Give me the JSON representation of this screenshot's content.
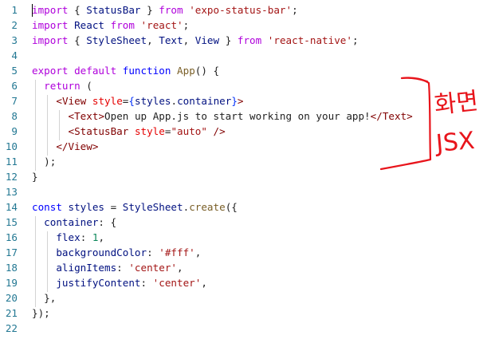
{
  "editor": {
    "lines": [
      {
        "n": "1",
        "tokens": [
          [
            "kw",
            "import"
          ],
          [
            "p",
            " { "
          ],
          [
            "v",
            "StatusBar"
          ],
          [
            "p",
            " } "
          ],
          [
            "kw",
            "from"
          ],
          [
            "p",
            " "
          ],
          [
            "s",
            "'expo-status-bar'"
          ],
          [
            "p",
            ";"
          ]
        ]
      },
      {
        "n": "2",
        "tokens": [
          [
            "kw",
            "import"
          ],
          [
            "p",
            " "
          ],
          [
            "v",
            "React"
          ],
          [
            "p",
            " "
          ],
          [
            "kw",
            "from"
          ],
          [
            "p",
            " "
          ],
          [
            "s",
            "'react'"
          ],
          [
            "p",
            ";"
          ]
        ]
      },
      {
        "n": "3",
        "tokens": [
          [
            "kw",
            "import"
          ],
          [
            "p",
            " { "
          ],
          [
            "v",
            "StyleSheet"
          ],
          [
            "p",
            ", "
          ],
          [
            "v",
            "Text"
          ],
          [
            "p",
            ", "
          ],
          [
            "v",
            "View"
          ],
          [
            "p",
            " } "
          ],
          [
            "kw",
            "from"
          ],
          [
            "p",
            " "
          ],
          [
            "s",
            "'react-native'"
          ],
          [
            "p",
            ";"
          ]
        ]
      },
      {
        "n": "4",
        "tokens": []
      },
      {
        "n": "5",
        "tokens": [
          [
            "kw",
            "export"
          ],
          [
            "p",
            " "
          ],
          [
            "kw",
            "default"
          ],
          [
            "p",
            " "
          ],
          [
            "k2",
            "function"
          ],
          [
            "p",
            " "
          ],
          [
            "f",
            "App"
          ],
          [
            "p",
            "() {"
          ]
        ]
      },
      {
        "n": "6",
        "tokens": [
          [
            "p",
            "  "
          ],
          [
            "kw",
            "return"
          ],
          [
            "p",
            " ("
          ]
        ]
      },
      {
        "n": "7",
        "tokens": [
          [
            "p",
            "    "
          ],
          [
            "tg",
            "<"
          ],
          [
            "tg",
            "View"
          ],
          [
            "p",
            " "
          ],
          [
            "at",
            "style"
          ],
          [
            "p",
            "="
          ],
          [
            "b",
            "{"
          ],
          [
            "v",
            "styles"
          ],
          [
            "p",
            "."
          ],
          [
            "v",
            "container"
          ],
          [
            "b",
            "}"
          ],
          [
            "tg",
            ">"
          ]
        ]
      },
      {
        "n": "8",
        "tokens": [
          [
            "p",
            "      "
          ],
          [
            "tg",
            "<"
          ],
          [
            "tg",
            "Text"
          ],
          [
            "tg",
            ">"
          ],
          [
            "p",
            "Open up App.js to start working on your app!"
          ],
          [
            "tg",
            "</"
          ],
          [
            "tg",
            "Text"
          ],
          [
            "tg",
            ">"
          ]
        ]
      },
      {
        "n": "9",
        "tokens": [
          [
            "p",
            "      "
          ],
          [
            "tg",
            "<"
          ],
          [
            "tg",
            "StatusBar"
          ],
          [
            "p",
            " "
          ],
          [
            "at",
            "style"
          ],
          [
            "p",
            "="
          ],
          [
            "s",
            "\"auto\""
          ],
          [
            "p",
            " "
          ],
          [
            "tg",
            "/>"
          ]
        ]
      },
      {
        "n": "10",
        "tokens": [
          [
            "p",
            "    "
          ],
          [
            "tg",
            "</"
          ],
          [
            "tg",
            "View"
          ],
          [
            "tg",
            ">"
          ]
        ]
      },
      {
        "n": "11",
        "tokens": [
          [
            "p",
            "  );"
          ]
        ]
      },
      {
        "n": "12",
        "tokens": [
          [
            "p",
            "}"
          ]
        ]
      },
      {
        "n": "13",
        "tokens": []
      },
      {
        "n": "14",
        "tokens": [
          [
            "k2",
            "const"
          ],
          [
            "p",
            " "
          ],
          [
            "v",
            "styles"
          ],
          [
            "p",
            " = "
          ],
          [
            "v",
            "StyleSheet"
          ],
          [
            "p",
            "."
          ],
          [
            "f",
            "create"
          ],
          [
            "p",
            "({"
          ]
        ]
      },
      {
        "n": "15",
        "tokens": [
          [
            "p",
            "  "
          ],
          [
            "v",
            "container"
          ],
          [
            "p",
            ": {"
          ]
        ]
      },
      {
        "n": "16",
        "tokens": [
          [
            "p",
            "    "
          ],
          [
            "v",
            "flex"
          ],
          [
            "p",
            ": "
          ],
          [
            "num",
            "1"
          ],
          [
            "p",
            ","
          ]
        ]
      },
      {
        "n": "17",
        "tokens": [
          [
            "p",
            "    "
          ],
          [
            "v",
            "backgroundColor"
          ],
          [
            "p",
            ": "
          ],
          [
            "s",
            "'#fff'"
          ],
          [
            "p",
            ","
          ]
        ]
      },
      {
        "n": "18",
        "tokens": [
          [
            "p",
            "    "
          ],
          [
            "v",
            "alignItems"
          ],
          [
            "p",
            ": "
          ],
          [
            "s",
            "'center'"
          ],
          [
            "p",
            ","
          ]
        ]
      },
      {
        "n": "19",
        "tokens": [
          [
            "p",
            "    "
          ],
          [
            "v",
            "justifyContent"
          ],
          [
            "p",
            ": "
          ],
          [
            "s",
            "'center'"
          ],
          [
            "p",
            ","
          ]
        ]
      },
      {
        "n": "20",
        "tokens": [
          [
            "p",
            "  },"
          ]
        ]
      },
      {
        "n": "21",
        "tokens": [
          [
            "p",
            "});"
          ]
        ]
      },
      {
        "n": "22",
        "tokens": []
      }
    ]
  },
  "annotation": {
    "handwritten_text": [
      "화면",
      "JSX"
    ],
    "color": "#e8141b"
  },
  "colors": {
    "keyword": "#af00db",
    "storage": "#0000ff",
    "string": "#a31515",
    "function": "#795e26",
    "variable": "#001080",
    "number": "#098658",
    "tag": "#800000",
    "attribute": "#e50000",
    "line_number": "#237893"
  }
}
